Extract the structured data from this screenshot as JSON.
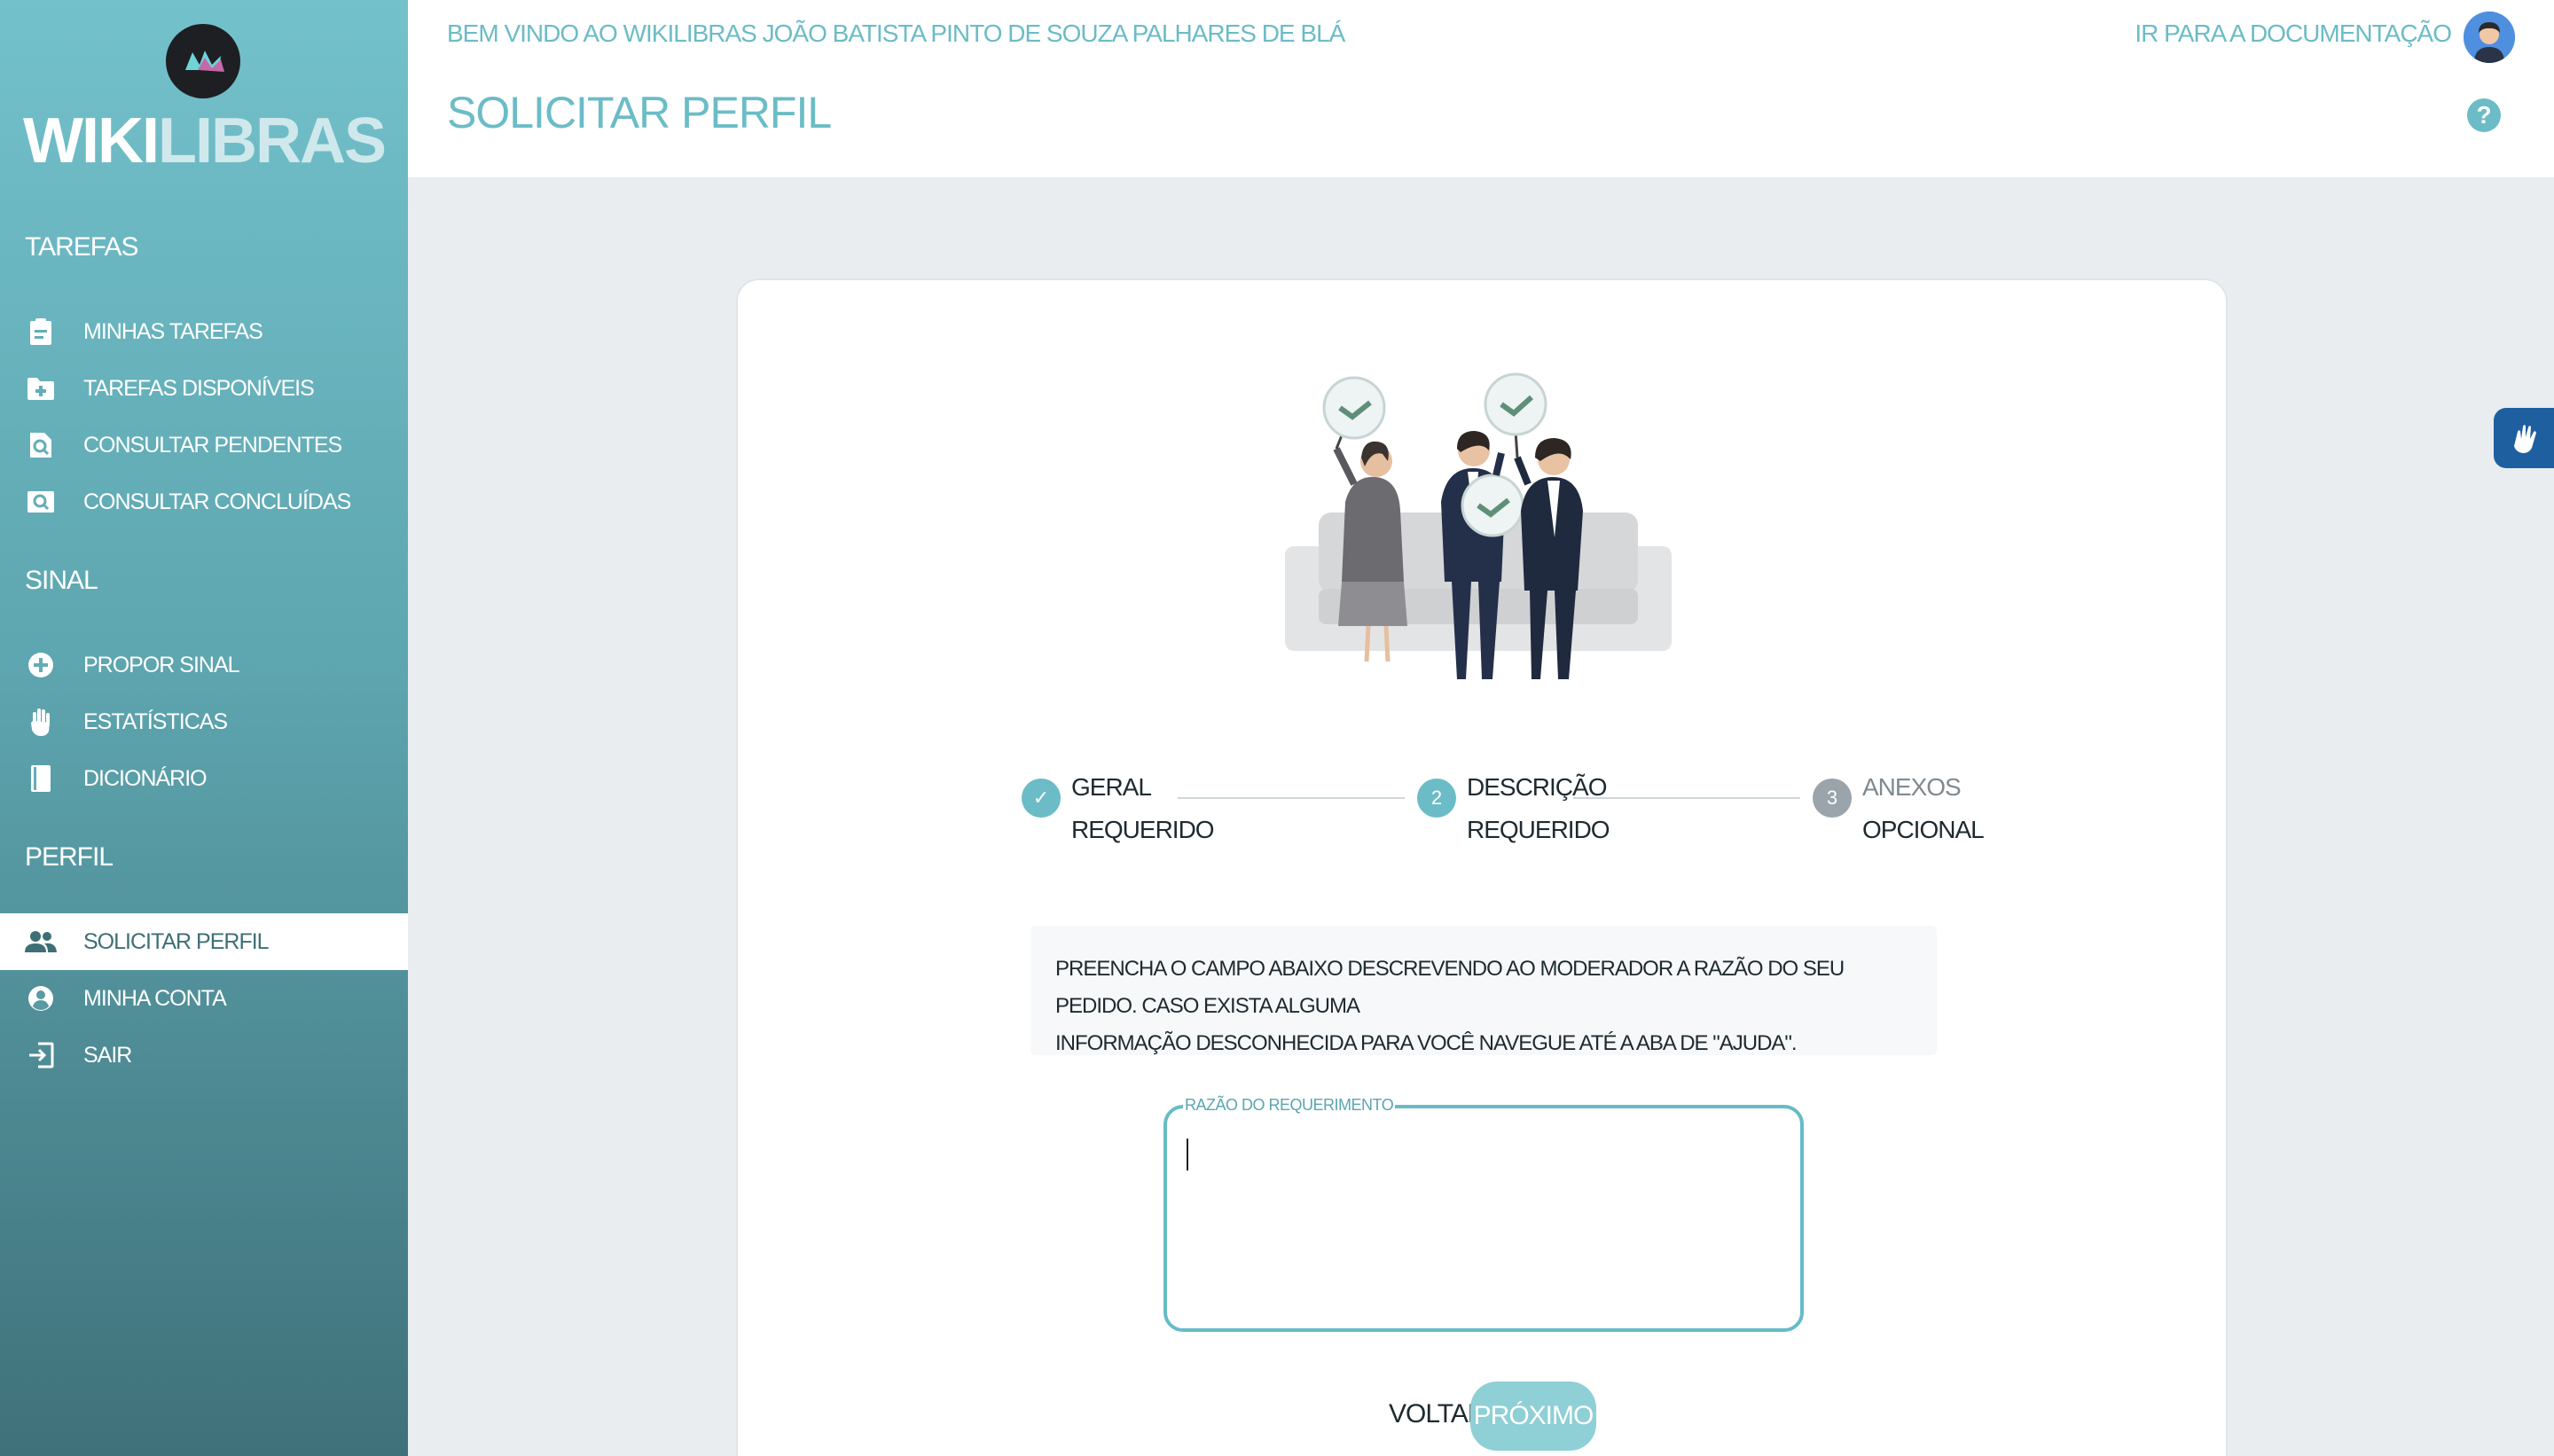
{
  "brand": {
    "name_part1": "WIKI",
    "name_part2": "LIBRAS"
  },
  "sidebar": {
    "sections": [
      {
        "title": "TAREFAS",
        "items": [
          {
            "label": "MINHAS TAREFAS",
            "icon": "clipboard-icon"
          },
          {
            "label": "TAREFAS DISPONÍVEIS",
            "icon": "folder-plus-icon"
          },
          {
            "label": "CONSULTAR PENDENTES",
            "icon": "file-search-icon"
          },
          {
            "label": "CONSULTAR CONCLUÍDAS",
            "icon": "image-search-icon"
          }
        ]
      },
      {
        "title": "SINAL",
        "items": [
          {
            "label": "PROPOR SINAL",
            "icon": "plus-circle-icon"
          },
          {
            "label": "ESTATÍSTICAS",
            "icon": "hand-icon"
          },
          {
            "label": "DICIONÁRIO",
            "icon": "book-icon"
          }
        ]
      },
      {
        "title": "PERFIL",
        "items": [
          {
            "label": "SOLICITAR PERFIL",
            "icon": "people-icon",
            "active": true
          },
          {
            "label": "MINHA CONTA",
            "icon": "account-circle-icon"
          },
          {
            "label": "SAIR",
            "icon": "logout-icon"
          }
        ]
      }
    ]
  },
  "header": {
    "welcome": "BEM VINDO AO WIKILIBRAS JOÃO BATISTA PINTO DE SOUZA PALHARES DE BLÁ",
    "title": "SOLICITAR PERFIL",
    "doc_link": "IR PARA A DOCUMENTAÇÃO"
  },
  "stepper": {
    "steps": [
      {
        "name": "GERAL",
        "status": "REQUERIDO",
        "marker": "✓",
        "state": "done"
      },
      {
        "name": "DESCRIÇÃO",
        "status": "REQUERIDO",
        "marker": "2",
        "state": "active"
      },
      {
        "name": "ANEXOS",
        "status": "OPCIONAL",
        "marker": "3",
        "state": "pending"
      }
    ]
  },
  "info": {
    "line1": "PREENCHA O CAMPO ABAIXO DESCREVENDO AO MODERADOR A RAZÃO DO SEU PEDIDO. CASO EXISTA ALGUMA",
    "line2": "INFORMAÇÃO DESCONHECIDA PARA VOCÊ NAVEGUE ATÉ A ABA DE \"AJUDA\"."
  },
  "form": {
    "field_label": "RAZÃO DO REQUERIMENTO",
    "field_value": ""
  },
  "actions": {
    "back": "VOLTAR",
    "next": "PRÓXIMO"
  },
  "colors": {
    "accent": "#6bbcc6",
    "sidebar_top": "#73c1cb",
    "sidebar_bottom": "#3f717a",
    "pending_step": "#9aa4aa"
  }
}
